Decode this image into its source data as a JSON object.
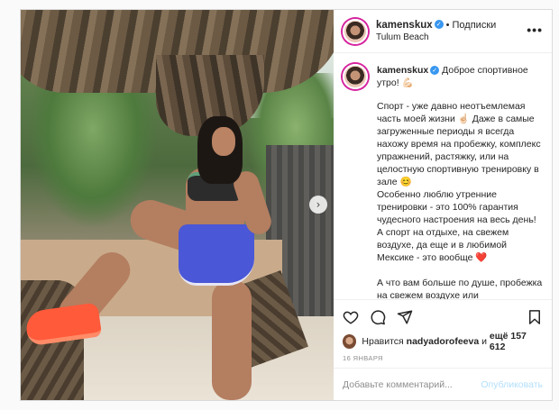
{
  "post": {
    "username": "kamenskux",
    "verified_glyph": "✓",
    "separator": "•",
    "follow_label": "Подписки",
    "location": "Tulum Beach",
    "more_glyph": "•••",
    "next_glyph": "›",
    "caption": {
      "lead": "Доброе спортивное утро! 💪🏻",
      "body": "Спорт - уже давно неотъемлемая часть моей жизни ☝🏻 Даже в самые загруженные периоды я всегда нахожу время на пробежку, комплекс упражнений, растяжку, или на целостную спортивную тренировку в зале 😊\nОсобенно люблю утренние тренировки - это 100% гарантия чудесного настроения на весь день!\nА спорт на отдыхе, на свежем воздухе, да еще и в любимой Мексике - это вообще ❤️\n\nА что вам больше по душе, пробежка на свежем воздухе или"
    },
    "likes": {
      "prefix": "Нравится",
      "user": "nadyadorofeeva",
      "middle": "и",
      "count": "ещё 157 612"
    },
    "date": "16 ЯНВАРЯ",
    "comment": {
      "placeholder": "Добавьте комментарий...",
      "publish_label": "Опубликовать"
    }
  },
  "icons": {
    "like": "heart-icon",
    "comment": "comment-icon",
    "share": "share-icon",
    "save": "bookmark-icon",
    "more": "more-icon",
    "next": "chevron-right-icon"
  },
  "colors": {
    "story_ring": "#d6249f",
    "verified": "#3897f0",
    "publish_disabled": "#b2dffc",
    "muted": "#8e8e8e"
  }
}
